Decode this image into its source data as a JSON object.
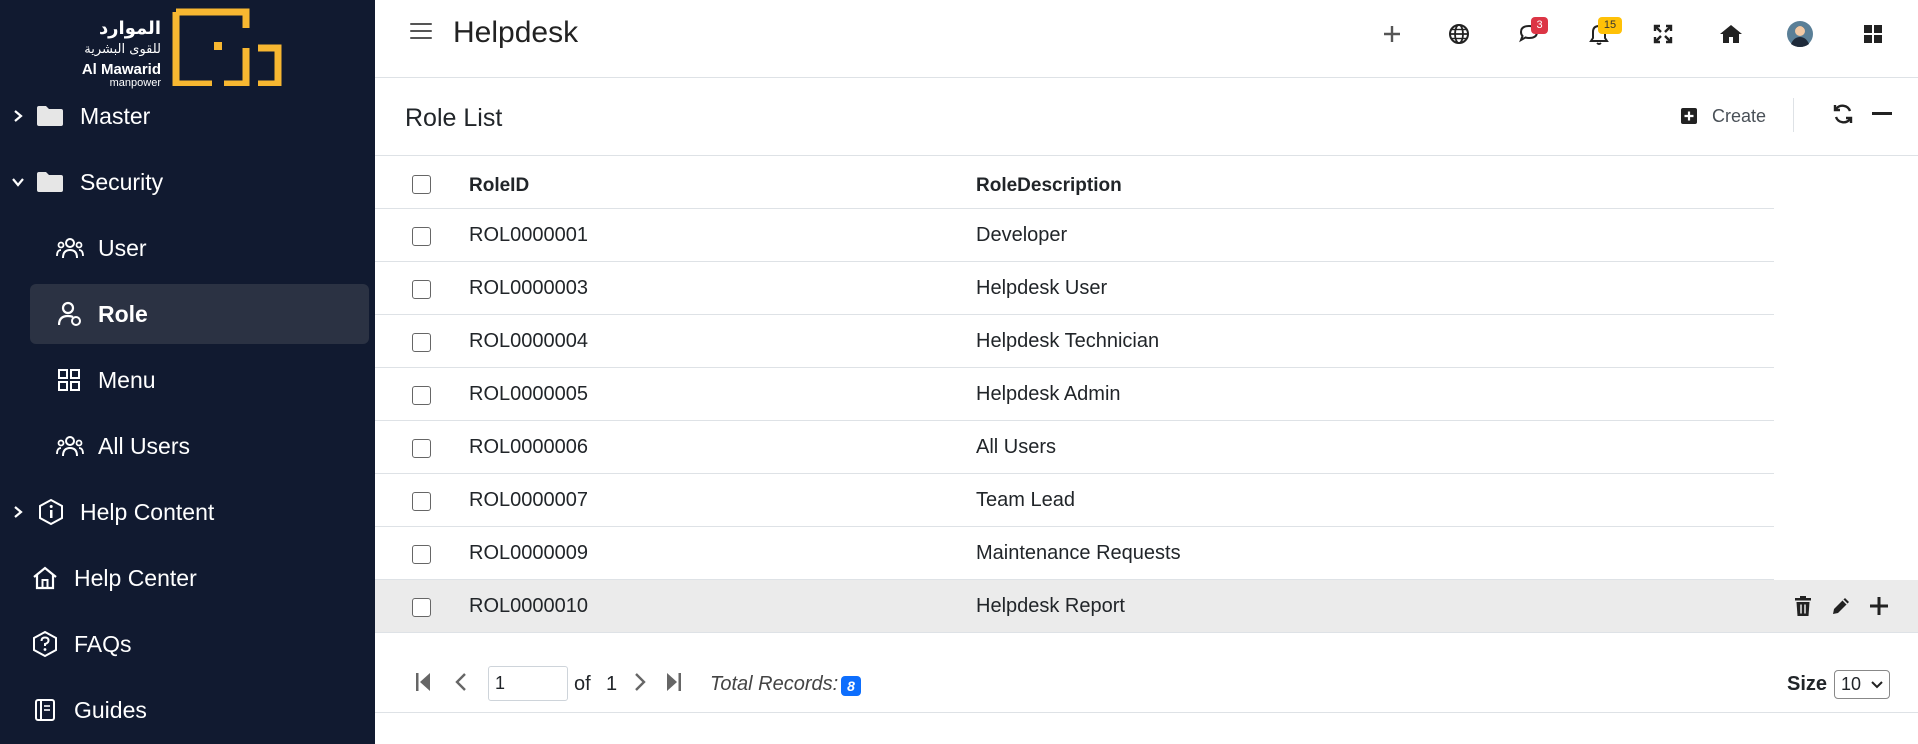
{
  "brand": {
    "arabic_name": "الموارد",
    "arabic_sub": "للقوى البشرية",
    "english_name": "Al Mawarid",
    "english_sub": "manpower",
    "logo_color": "#f7b731"
  },
  "sidebar": {
    "items": [
      {
        "label": "Master",
        "icon": "folder-icon",
        "expandable": true,
        "expanded": false
      },
      {
        "label": "Security",
        "icon": "folder-icon",
        "expandable": true,
        "expanded": true
      },
      {
        "label": "User",
        "icon": "users-icon",
        "child": true
      },
      {
        "label": "Role",
        "icon": "user-role-icon",
        "child": true,
        "active": true
      },
      {
        "label": "Menu",
        "icon": "grid-icon",
        "child": true
      },
      {
        "label": "All Users",
        "icon": "users-icon",
        "child": true
      },
      {
        "label": "Help Content",
        "icon": "info-icon",
        "expandable": true,
        "expanded": false
      },
      {
        "label": "Help Center",
        "icon": "home-icon"
      },
      {
        "label": "FAQs",
        "icon": "question-icon"
      },
      {
        "label": "Guides",
        "icon": "book-icon"
      }
    ]
  },
  "header": {
    "title": "Helpdesk",
    "messages_badge": "3",
    "notifications_badge": "15",
    "icons": [
      "plus-icon",
      "globe-icon",
      "chat-icon",
      "bell-icon",
      "expand-icon",
      "home-icon",
      "avatar",
      "apps-icon"
    ]
  },
  "card": {
    "title": "Role List",
    "create_label": "Create"
  },
  "table": {
    "columns": [
      "RoleID",
      "RoleDescription"
    ],
    "rows": [
      {
        "id": "ROL0000001",
        "desc": "Developer"
      },
      {
        "id": "ROL0000003",
        "desc": "Helpdesk User"
      },
      {
        "id": "ROL0000004",
        "desc": "Helpdesk Technician"
      },
      {
        "id": "ROL0000005",
        "desc": "Helpdesk Admin"
      },
      {
        "id": "ROL0000006",
        "desc": "All Users"
      },
      {
        "id": "ROL0000007",
        "desc": "Team Lead"
      },
      {
        "id": "ROL0000009",
        "desc": "Maintenance Requests"
      },
      {
        "id": "ROL0000010",
        "desc": "Helpdesk Report"
      }
    ]
  },
  "pagination": {
    "current_page": "1",
    "of_label": "of",
    "total_pages": "1",
    "total_label": "Total Records:",
    "total_records": "8",
    "size_label": "Size",
    "size_value": "10"
  },
  "colors": {
    "sidebar_bg": "#111a30",
    "sidebar_active": "#2b3243",
    "badge_red": "#dc3545",
    "badge_yellow": "#ffc107",
    "badge_blue": "#0d6efd"
  }
}
